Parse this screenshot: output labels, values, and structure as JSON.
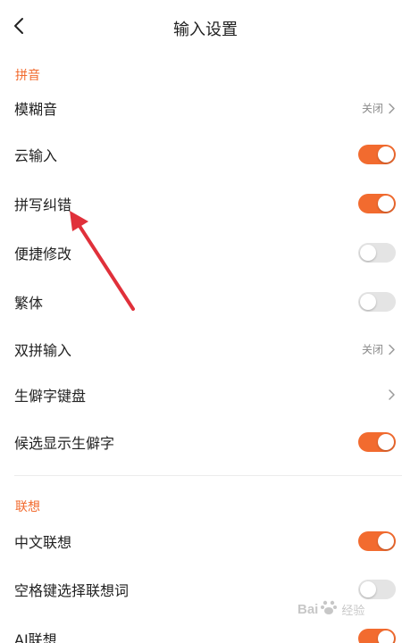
{
  "header": {
    "back_icon": "chevron-left-icon",
    "title": "输入设置"
  },
  "colors": {
    "accent": "#f26b2f",
    "toggle_off": "#e4e4e4",
    "section_label": "#f26b2f",
    "annotation_arrow": "#e0303a"
  },
  "sections": [
    {
      "label": "拼音",
      "rows": [
        {
          "label": "模糊音",
          "type": "link",
          "value": "关闭"
        },
        {
          "label": "云输入",
          "type": "toggle",
          "on": true
        },
        {
          "label": "拼写纠错",
          "type": "toggle",
          "on": true
        },
        {
          "label": "便捷修改",
          "type": "toggle",
          "on": false
        },
        {
          "label": "繁体",
          "type": "toggle",
          "on": false
        },
        {
          "label": "双拼输入",
          "type": "link",
          "value": "关闭"
        },
        {
          "label": "生僻字键盘",
          "type": "link",
          "value": ""
        },
        {
          "label": "候选显示生僻字",
          "type": "toggle",
          "on": true
        }
      ]
    },
    {
      "label": "联想",
      "rows": [
        {
          "label": "中文联想",
          "type": "toggle",
          "on": true
        },
        {
          "label": "空格键选择联想词",
          "type": "toggle",
          "on": false
        },
        {
          "label": "AI联想",
          "type": "toggle",
          "on": true
        }
      ]
    }
  ],
  "watermark": {
    "brand_left": "Bai",
    "brand_right": "经验",
    "icon": "paw-icon"
  }
}
